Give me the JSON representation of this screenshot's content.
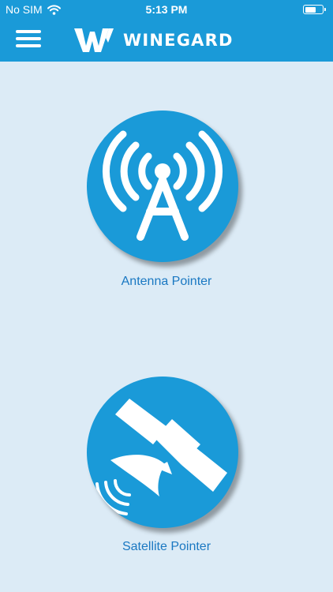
{
  "status_bar": {
    "carrier": "No SIM",
    "time": "5:13 PM",
    "battery_level": 0.68
  },
  "header": {
    "brand": "WINEGARD",
    "menu_icon": "hamburger-icon",
    "logo_icon": "winegard-w-icon"
  },
  "tools": [
    {
      "label": "Antenna Pointer",
      "icon": "antenna-tower-icon"
    },
    {
      "label": "Satellite Pointer",
      "icon": "satellite-icon"
    }
  ],
  "colors": {
    "brand_blue": "#1a9ad8",
    "background": "#dcebf6",
    "label_blue": "#1a78c2",
    "white": "#ffffff"
  }
}
